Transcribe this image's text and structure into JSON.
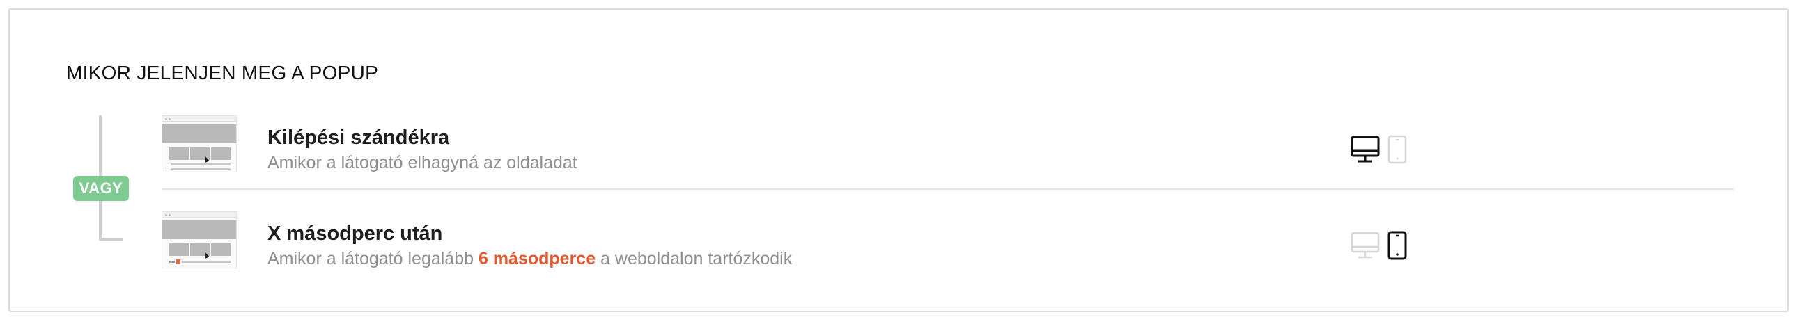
{
  "section": {
    "title": "MIKOR JELENJEN MEG A POPUP"
  },
  "connector": {
    "label": "VAGY"
  },
  "triggers": [
    {
      "title": "Kilépési szándékra",
      "description": "Amikor a látogató elhagyná az oldaladat",
      "desktop_active": true,
      "mobile_active": false
    },
    {
      "title": "X másodperc után",
      "description_before": "Amikor a látogató legalább ",
      "description_highlight": "6 másodperce",
      "description_after": " a weboldalon tartózkodik",
      "desktop_active": false,
      "mobile_active": true
    }
  ],
  "colors": {
    "accent_green": "#7ecb91",
    "highlight_orange": "#e0592f",
    "icon_active": "#111111",
    "icon_inactive": "#d6d6d6"
  }
}
